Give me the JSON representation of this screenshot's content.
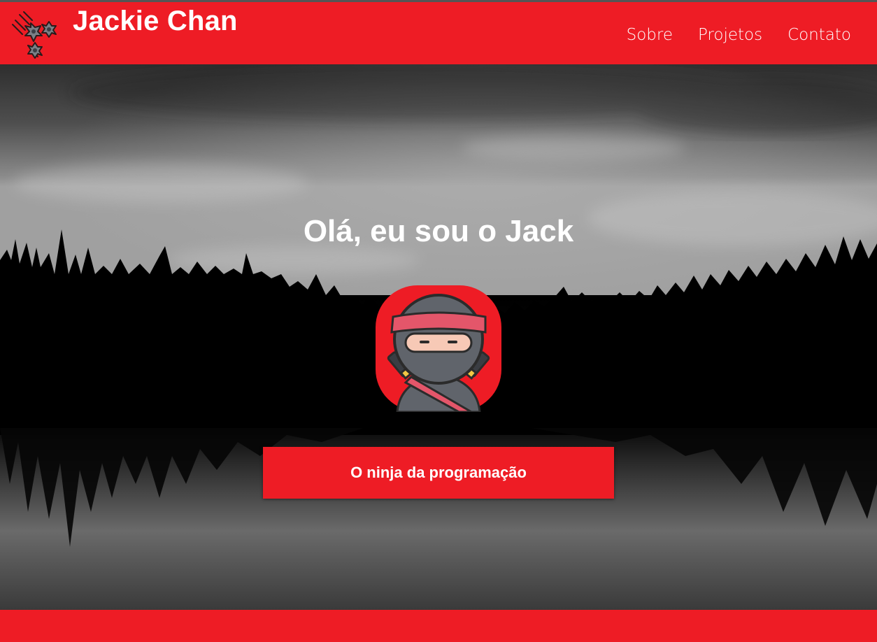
{
  "header": {
    "brand": "Jackie Chan",
    "logo_icon": "shuriken-icon",
    "nav": [
      {
        "label": "Sobre"
      },
      {
        "label": "Projetos"
      },
      {
        "label": "Contato"
      }
    ]
  },
  "hero": {
    "title": "Olá, eu sou o Jack",
    "avatar_icon": "ninja-avatar-icon",
    "background": "grayscale-forest-lake-photo",
    "cta_label": "O ninja da programação"
  },
  "colors": {
    "accent": "#ee1c25",
    "text": "#ffffff"
  }
}
